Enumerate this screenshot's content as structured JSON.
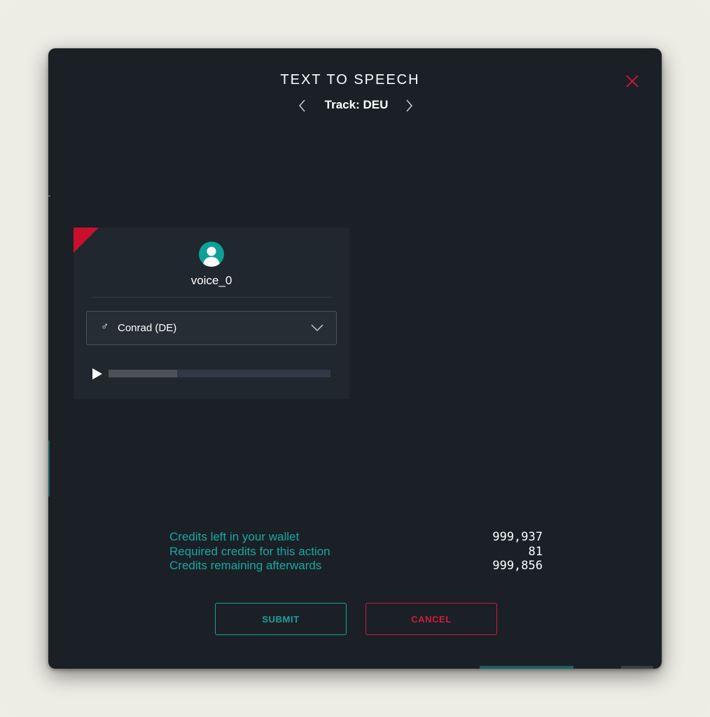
{
  "modal": {
    "title": "TEXT TO SPEECH",
    "track_label": "Track: DEU"
  },
  "voice_card": {
    "name": "voice_0",
    "selected_voice": "Conrad (DE)",
    "gender_symbol": "♂",
    "playback_progress_percent": 31
  },
  "credits": [
    {
      "label": "Credits left in your wallet",
      "value": "999,937"
    },
    {
      "label": "Required credits for this action",
      "value": "81"
    },
    {
      "label": "Credits remaining afterwards",
      "value": "999,856"
    }
  ],
  "actions": {
    "submit_label": "SUBMIT",
    "cancel_label": "CANCEL"
  },
  "icons": {
    "close": "close-icon",
    "prev": "chevron-left-icon",
    "next": "chevron-right-icon",
    "avatar": "user-icon",
    "dropdown": "chevron-down-icon",
    "play": "play-icon",
    "gender": "male-icon"
  },
  "colors": {
    "background": "#1b2026",
    "card": "#21272e",
    "accent_teal": "#14a9a3",
    "accent_red": "#cf1a3d",
    "page": "#eeede5"
  }
}
